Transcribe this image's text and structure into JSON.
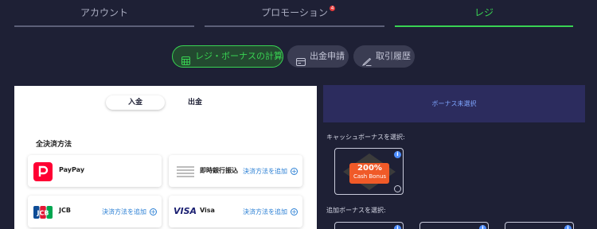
{
  "tabs": [
    {
      "label": "アカウント"
    },
    {
      "label": "プロモーション",
      "badge": "4"
    },
    {
      "label": "レジ",
      "active": true
    }
  ],
  "pills": [
    {
      "label": "レジ・ボーナスの計算",
      "icon": "calculator-icon",
      "active": true
    },
    {
      "label": "出金申請",
      "icon": "card-icon"
    },
    {
      "label": "取引履歴",
      "icon": "pencil-icon"
    }
  ],
  "segments": {
    "deposit": "入金",
    "withdraw": "出金"
  },
  "payment": {
    "section_title": "全決済方法",
    "methods": [
      {
        "name": "PayPay",
        "icon": "paypay-logo"
      },
      {
        "name": "即時銀行振込",
        "icon": "bank-transfer-icon",
        "action": "決済方法を追加"
      },
      {
        "name": "JCB",
        "icon": "jcb-logo",
        "action": "決済方法を追加"
      },
      {
        "name": "Visa",
        "icon": "visa-logo",
        "logo_text": "VISA",
        "action": "決済方法を追加"
      }
    ]
  },
  "bonus": {
    "status": "ボーナス未選択",
    "cashback_label": "キャッシュボーナスを選択:",
    "card": {
      "pct": "200%",
      "text": "Cash Bonus"
    },
    "extra_label": "追加ボーナスを選択:"
  },
  "colors": {
    "accent": "#39d353",
    "background": "#1e2035",
    "bonus_orange": "#f05a28",
    "link": "#2a7fd4"
  }
}
